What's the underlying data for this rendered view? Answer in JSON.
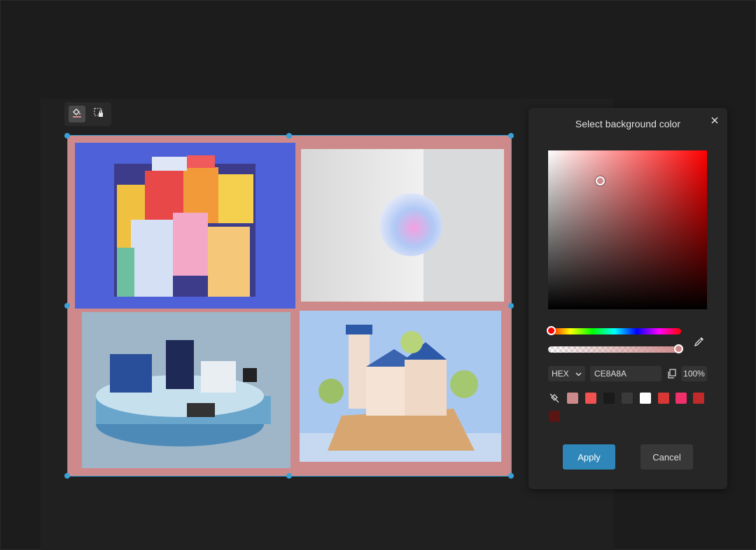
{
  "panel": {
    "title": "Select background color",
    "format": "HEX",
    "hex_value": "CE8A8A",
    "alpha": "100%",
    "apply_label": "Apply",
    "cancel_label": "Cancel",
    "selected_color": "#CE8A8A",
    "swatches": [
      "#CE8A8A",
      "#F05252",
      "#1A1A1A",
      "#3A3A3A",
      "#FFFFFF",
      "#D93636",
      "#F0306A",
      "#C12A2A",
      "#5A1414"
    ]
  },
  "toolbar": {
    "icons": [
      "paint-bucket-icon",
      "crop-lock-icon"
    ]
  },
  "collage": {
    "background": "#CE8A8A",
    "images": [
      "isometric-city-buildings",
      "iridescent-sphere",
      "isometric-shop-platform",
      "lighthouse-island"
    ]
  },
  "icons": [
    "close-icon",
    "eyedropper-icon",
    "copy-icon",
    "chevron-down-icon",
    "no-color-icon"
  ]
}
